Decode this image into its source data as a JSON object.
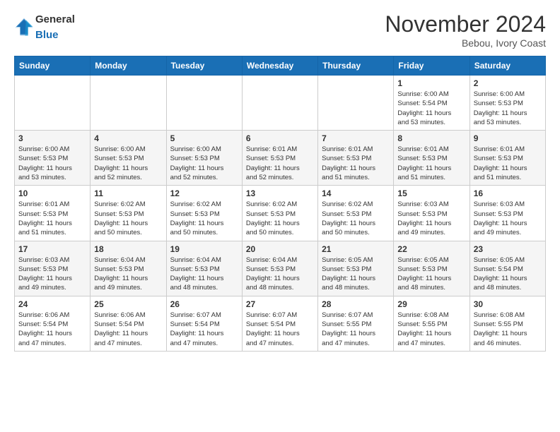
{
  "header": {
    "logo_general": "General",
    "logo_blue": "Blue",
    "month_title": "November 2024",
    "location": "Bebou, Ivory Coast"
  },
  "weekdays": [
    "Sunday",
    "Monday",
    "Tuesday",
    "Wednesday",
    "Thursday",
    "Friday",
    "Saturday"
  ],
  "weeks": [
    [
      {
        "day": "",
        "info": ""
      },
      {
        "day": "",
        "info": ""
      },
      {
        "day": "",
        "info": ""
      },
      {
        "day": "",
        "info": ""
      },
      {
        "day": "",
        "info": ""
      },
      {
        "day": "1",
        "info": "Sunrise: 6:00 AM\nSunset: 5:54 PM\nDaylight: 11 hours\nand 53 minutes."
      },
      {
        "day": "2",
        "info": "Sunrise: 6:00 AM\nSunset: 5:53 PM\nDaylight: 11 hours\nand 53 minutes."
      }
    ],
    [
      {
        "day": "3",
        "info": "Sunrise: 6:00 AM\nSunset: 5:53 PM\nDaylight: 11 hours\nand 53 minutes."
      },
      {
        "day": "4",
        "info": "Sunrise: 6:00 AM\nSunset: 5:53 PM\nDaylight: 11 hours\nand 52 minutes."
      },
      {
        "day": "5",
        "info": "Sunrise: 6:00 AM\nSunset: 5:53 PM\nDaylight: 11 hours\nand 52 minutes."
      },
      {
        "day": "6",
        "info": "Sunrise: 6:01 AM\nSunset: 5:53 PM\nDaylight: 11 hours\nand 52 minutes."
      },
      {
        "day": "7",
        "info": "Sunrise: 6:01 AM\nSunset: 5:53 PM\nDaylight: 11 hours\nand 51 minutes."
      },
      {
        "day": "8",
        "info": "Sunrise: 6:01 AM\nSunset: 5:53 PM\nDaylight: 11 hours\nand 51 minutes."
      },
      {
        "day": "9",
        "info": "Sunrise: 6:01 AM\nSunset: 5:53 PM\nDaylight: 11 hours\nand 51 minutes."
      }
    ],
    [
      {
        "day": "10",
        "info": "Sunrise: 6:01 AM\nSunset: 5:53 PM\nDaylight: 11 hours\nand 51 minutes."
      },
      {
        "day": "11",
        "info": "Sunrise: 6:02 AM\nSunset: 5:53 PM\nDaylight: 11 hours\nand 50 minutes."
      },
      {
        "day": "12",
        "info": "Sunrise: 6:02 AM\nSunset: 5:53 PM\nDaylight: 11 hours\nand 50 minutes."
      },
      {
        "day": "13",
        "info": "Sunrise: 6:02 AM\nSunset: 5:53 PM\nDaylight: 11 hours\nand 50 minutes."
      },
      {
        "day": "14",
        "info": "Sunrise: 6:02 AM\nSunset: 5:53 PM\nDaylight: 11 hours\nand 50 minutes."
      },
      {
        "day": "15",
        "info": "Sunrise: 6:03 AM\nSunset: 5:53 PM\nDaylight: 11 hours\nand 49 minutes."
      },
      {
        "day": "16",
        "info": "Sunrise: 6:03 AM\nSunset: 5:53 PM\nDaylight: 11 hours\nand 49 minutes."
      }
    ],
    [
      {
        "day": "17",
        "info": "Sunrise: 6:03 AM\nSunset: 5:53 PM\nDaylight: 11 hours\nand 49 minutes."
      },
      {
        "day": "18",
        "info": "Sunrise: 6:04 AM\nSunset: 5:53 PM\nDaylight: 11 hours\nand 49 minutes."
      },
      {
        "day": "19",
        "info": "Sunrise: 6:04 AM\nSunset: 5:53 PM\nDaylight: 11 hours\nand 48 minutes."
      },
      {
        "day": "20",
        "info": "Sunrise: 6:04 AM\nSunset: 5:53 PM\nDaylight: 11 hours\nand 48 minutes."
      },
      {
        "day": "21",
        "info": "Sunrise: 6:05 AM\nSunset: 5:53 PM\nDaylight: 11 hours\nand 48 minutes."
      },
      {
        "day": "22",
        "info": "Sunrise: 6:05 AM\nSunset: 5:53 PM\nDaylight: 11 hours\nand 48 minutes."
      },
      {
        "day": "23",
        "info": "Sunrise: 6:05 AM\nSunset: 5:54 PM\nDaylight: 11 hours\nand 48 minutes."
      }
    ],
    [
      {
        "day": "24",
        "info": "Sunrise: 6:06 AM\nSunset: 5:54 PM\nDaylight: 11 hours\nand 47 minutes."
      },
      {
        "day": "25",
        "info": "Sunrise: 6:06 AM\nSunset: 5:54 PM\nDaylight: 11 hours\nand 47 minutes."
      },
      {
        "day": "26",
        "info": "Sunrise: 6:07 AM\nSunset: 5:54 PM\nDaylight: 11 hours\nand 47 minutes."
      },
      {
        "day": "27",
        "info": "Sunrise: 6:07 AM\nSunset: 5:54 PM\nDaylight: 11 hours\nand 47 minutes."
      },
      {
        "day": "28",
        "info": "Sunrise: 6:07 AM\nSunset: 5:55 PM\nDaylight: 11 hours\nand 47 minutes."
      },
      {
        "day": "29",
        "info": "Sunrise: 6:08 AM\nSunset: 5:55 PM\nDaylight: 11 hours\nand 47 minutes."
      },
      {
        "day": "30",
        "info": "Sunrise: 6:08 AM\nSunset: 5:55 PM\nDaylight: 11 hours\nand 46 minutes."
      }
    ]
  ]
}
